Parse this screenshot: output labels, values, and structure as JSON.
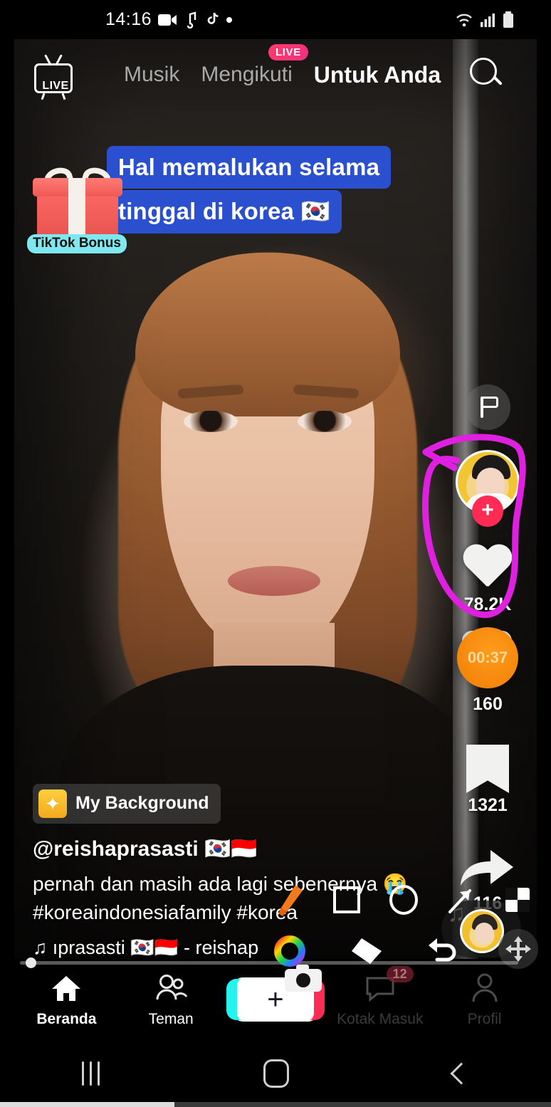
{
  "status_bar": {
    "time": "14:16",
    "icons": [
      "video-camera-icon",
      "music-note-icon",
      "tiktok-icon",
      "dot-icon"
    ],
    "right_icons": [
      "wifi-icon",
      "signal-icon",
      "battery-icon"
    ]
  },
  "top_nav": {
    "live_button_label": "LIVE",
    "tabs": [
      {
        "label": "Musik",
        "active": false
      },
      {
        "label": "Mengikuti",
        "active": false,
        "badge": "LIVE"
      },
      {
        "label": "Untuk Anda",
        "active": true
      }
    ],
    "search_icon": "search-icon"
  },
  "video": {
    "caption_lines": [
      "Hal memalukan selama",
      "tinggal di korea 🇰🇷"
    ],
    "bonus_sticker": {
      "label": "TikTok Bonus",
      "icon": "gift-box-icon"
    },
    "background_tag": {
      "label": "My Background",
      "icon": "magic-wand-icon"
    },
    "author_handle": "@reishaprasasti 🇰🇷🇮🇩",
    "description": "pernah dan masih ada lagi sebenernya 😭",
    "hashtags": "#koreaindonesiafamily #korea",
    "music_label": "♫  ıprasasti 🇰🇷🇮🇩 - reishap",
    "music_icon": "music-note-icon"
  },
  "action_rail": {
    "report_icon": "flag-icon",
    "avatar_icon": "profile-avatar",
    "follow_button_label": "+",
    "like": {
      "icon": "heart-icon",
      "count": "78.2K"
    },
    "comment": {
      "icon": "comment-icon",
      "count": "160"
    },
    "bookmark": {
      "icon": "bookmark-icon",
      "count": "1321"
    },
    "share": {
      "icon": "share-arrow-icon",
      "count": "116"
    },
    "timer_overlay": "00:37"
  },
  "bottom_nav": [
    {
      "label": "Beranda",
      "icon": "home-icon",
      "active": true
    },
    {
      "label": "Teman",
      "icon": "friends-icon",
      "active": false
    },
    {
      "label": "",
      "icon": "create-plus-icon",
      "active": false
    },
    {
      "label": "Kotak Masuk",
      "icon": "inbox-icon",
      "active": false,
      "badge": "12"
    },
    {
      "label": "Profil",
      "icon": "person-icon",
      "active": false
    }
  ],
  "annotation_toolbar": {
    "tools_row1": [
      "brush-icon",
      "square-icon",
      "circle-icon",
      "arrow-icon",
      "shapes-icon"
    ],
    "tools_row2": [
      "color-wheel-icon",
      "eraser-icon",
      "undo-icon"
    ],
    "drawing_color": "#e020e0"
  },
  "android_nav": {
    "recents_icon": "recents-icon",
    "home_icon": "home-square-icon",
    "back_icon": "back-chevron-icon"
  },
  "colors": {
    "accent_red": "#fe2c55",
    "accent_cyan": "#25f4ee",
    "caption_blue": "#2b50cf",
    "timer_orange": "#f58a08",
    "annotation_magenta": "#e020e0",
    "bonus_badge_cyan": "#7ee8ee"
  }
}
